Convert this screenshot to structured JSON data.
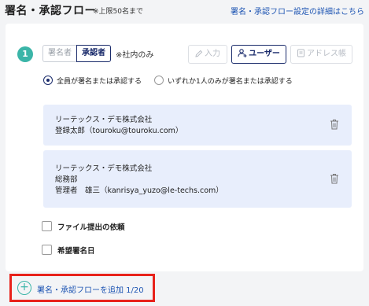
{
  "header": {
    "title": "署名・承認フロー",
    "limit_note": "※上限50名まで",
    "help_link": "署名・承認フロー設定の詳細はこちら"
  },
  "step": {
    "number": "1",
    "role_tabs": [
      {
        "label": "署名者",
        "selected": false
      },
      {
        "label": "承認者",
        "selected": true
      }
    ],
    "role_note": "※社内のみ",
    "buttons": {
      "input": "入力",
      "user": "ユーザー",
      "address_book": "アドレス帳"
    },
    "radio_options": [
      {
        "label": "全員が署名または承認する",
        "selected": true
      },
      {
        "label": "いずれか1人のみが署名または承認する",
        "selected": false
      }
    ],
    "assignees": [
      {
        "lines": [
          "リーテックス・デモ株式会社",
          "登録太郎（touroku@touroku.com）"
        ]
      },
      {
        "lines": [
          "リーテックス・デモ株式会社",
          "総務部",
          "管理者　雄三（kanrisya_yuzo@le-techs.com）"
        ]
      }
    ],
    "options": [
      {
        "label": "ファイル提出の依頼",
        "checked": false
      },
      {
        "label": "希望署名日",
        "checked": false
      }
    ]
  },
  "add_flow": {
    "label": "署名・承認フローを追加 1/20"
  },
  "colors": {
    "accent_navy": "#1a2b6b",
    "teal": "#3bb5a8",
    "link_blue": "#1e55b3",
    "assignee_bg": "#e8eefc",
    "highlight_red": "#e8221b"
  }
}
